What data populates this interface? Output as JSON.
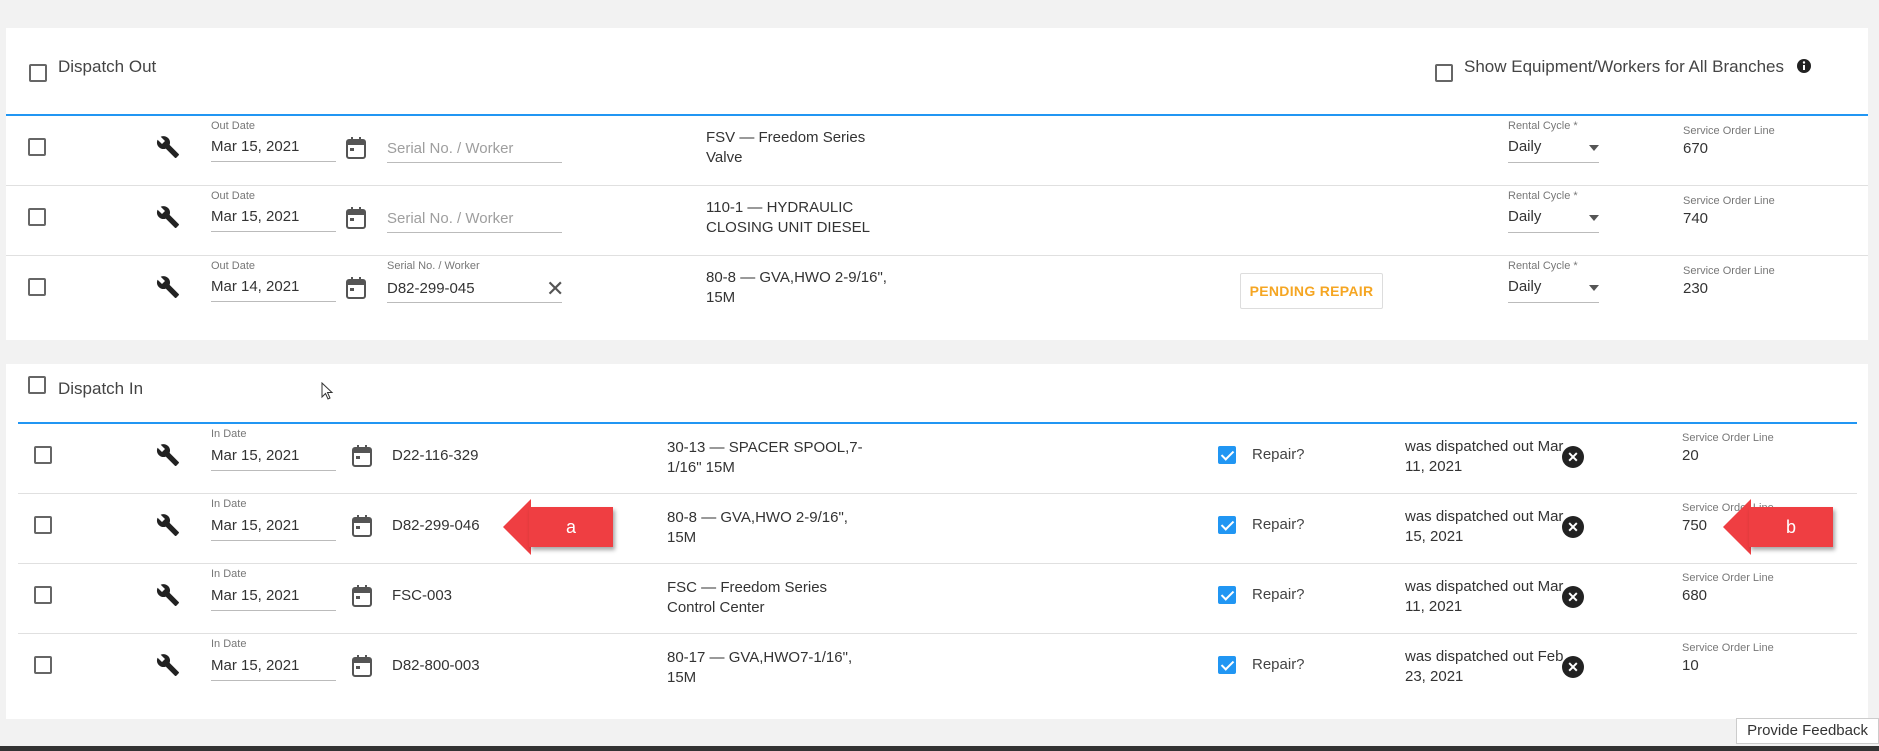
{
  "dispatch_out": {
    "title": "Dispatch Out",
    "show_all_label": "Show Equipment/Workers for All Branches",
    "date_label": "Out Date",
    "serial_label": "Serial No. / Worker",
    "serial_placeholder": "Serial No. / Worker",
    "rental_label": "Rental Cycle *",
    "sol_label": "Service Order Line",
    "rows": [
      {
        "date": "Mar 15, 2021",
        "serial": "",
        "desc1": "FSV — Freedom Series",
        "desc2": "Valve",
        "badge": "",
        "rental": "Daily",
        "sol": "670"
      },
      {
        "date": "Mar 15, 2021",
        "serial": "",
        "desc1": "110-1 — HYDRAULIC",
        "desc2": "CLOSING UNIT DIESEL",
        "badge": "",
        "rental": "Daily",
        "sol": "740"
      },
      {
        "date": "Mar 14, 2021",
        "serial": "D82-299-045",
        "desc1": "80-8 — GVA,HWO 2-9/16\",",
        "desc2": "15M",
        "badge": "PENDING REPAIR",
        "rental": "Daily",
        "sol": "230"
      }
    ]
  },
  "dispatch_in": {
    "title": "Dispatch In",
    "date_label": "In Date",
    "repair_label": "Repair?",
    "sol_label": "Service Order Line",
    "rows": [
      {
        "date": "Mar 15, 2021",
        "serial": "D22-116-329",
        "desc1": "30-13 — SPACER SPOOL,7-",
        "desc2": "1/16\" 15M",
        "dispatched1": "was dispatched out Mar",
        "dispatched2": "11, 2021",
        "sol": "20"
      },
      {
        "date": "Mar 15, 2021",
        "serial": "D82-299-046",
        "desc1": "80-8 — GVA,HWO 2-9/16\",",
        "desc2": "15M",
        "dispatched1": "was dispatched out Mar",
        "dispatched2": "15, 2021",
        "sol": "750"
      },
      {
        "date": "Mar 15, 2021",
        "serial": "FSC-003",
        "desc1": "FSC — Freedom Series",
        "desc2": "Control Center",
        "dispatched1": "was dispatched out Mar",
        "dispatched2": "11, 2021",
        "sol": "680"
      },
      {
        "date": "Mar 15, 2021",
        "serial": "D82-800-003",
        "desc1": "80-17 — GVA,HWO7-1/16\",",
        "desc2": "15M",
        "dispatched1": "was dispatched out Feb",
        "dispatched2": "23, 2021",
        "sol": "10"
      }
    ]
  },
  "annotations": {
    "a": "a",
    "b": "b"
  },
  "feedback_label": "Provide Feedback",
  "colors": {
    "accent": "#2196f3",
    "badge": "#f5a623",
    "annotation": "#ef3e42"
  }
}
